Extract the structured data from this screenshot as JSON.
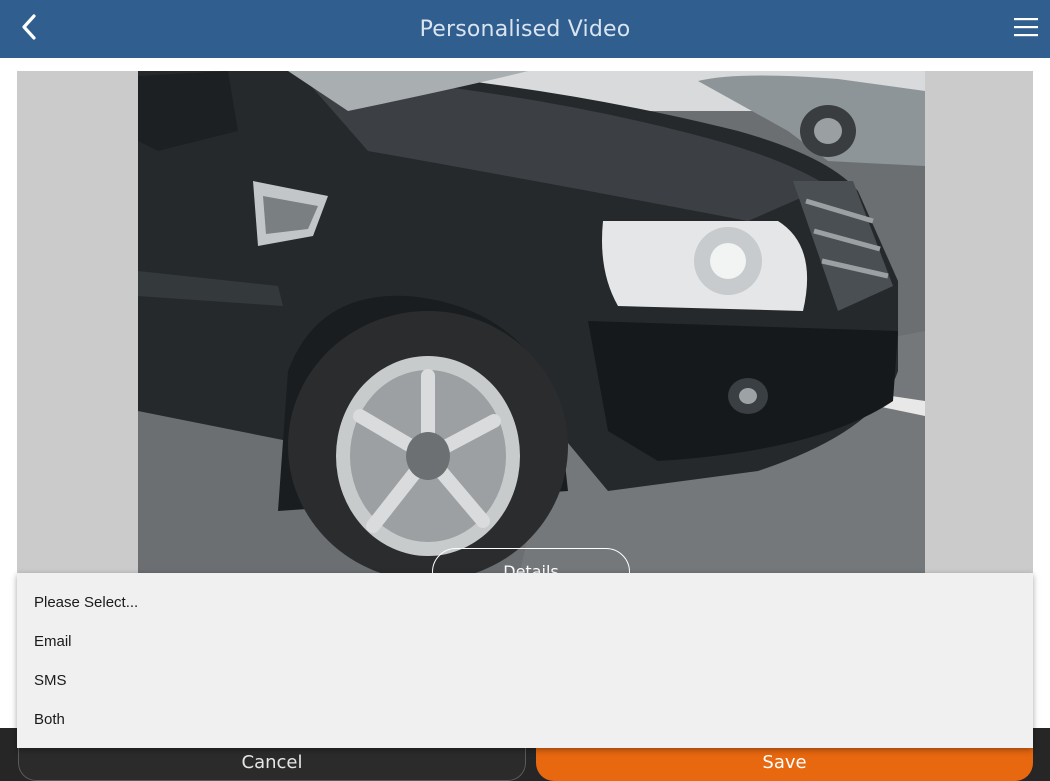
{
  "header": {
    "title": "Personalised Video",
    "back_icon": "chevron-left-icon",
    "menu_icon": "hamburger-menu-icon",
    "color": "#2f5e8f"
  },
  "preview": {
    "details_label": "Details"
  },
  "dropdown": {
    "options": [
      "Please Select...",
      "Email",
      "SMS",
      "Both"
    ]
  },
  "actions": {
    "cancel_label": "Cancel",
    "save_label": "Save",
    "save_color": "#e8680f"
  }
}
